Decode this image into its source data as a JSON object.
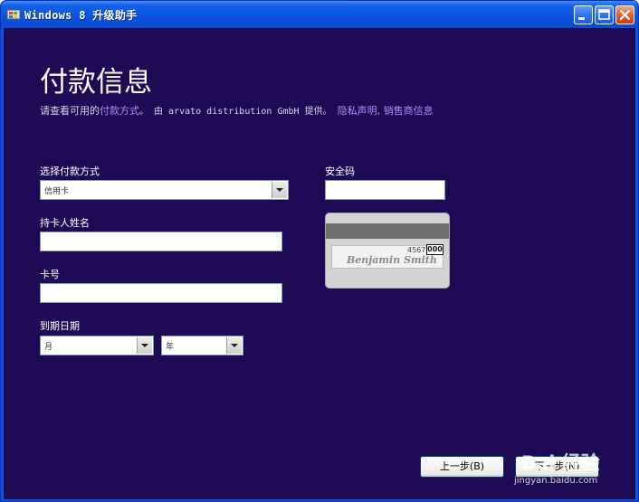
{
  "window": {
    "title": "Windows 8 升级助手"
  },
  "page": {
    "heading": "付款信息",
    "sub": {
      "prefix": "请查看可用的",
      "payment_link": "付款方式",
      "middle": "。 由 arvato distribution GmbH 提供。 ",
      "privacy_link": "隐私声明",
      "comma": ", ",
      "seller_link": "销售商信息"
    }
  },
  "form": {
    "payment_method": {
      "label": "选择付款方式",
      "value": "信用卡"
    },
    "cardholder": {
      "label": "持卡人姓名",
      "value": ""
    },
    "card_number": {
      "label": "卡号",
      "value": ""
    },
    "expiry": {
      "label": "到期日期",
      "month": "月",
      "year": "年"
    },
    "security_code": {
      "label": "安全码",
      "value": ""
    }
  },
  "card_illustration": {
    "number_fragment": "4567",
    "cvv": "000",
    "signature": "Benjamin Smith"
  },
  "buttons": {
    "back": "上一步(B)",
    "next": "下一步(N)"
  },
  "watermark": {
    "brand": "Bai 经验",
    "url": "jingyan.baidu.com"
  },
  "colors": {
    "background": "#1e0a54",
    "link": "#a98ef6",
    "titlebar": "#0a56e6"
  }
}
